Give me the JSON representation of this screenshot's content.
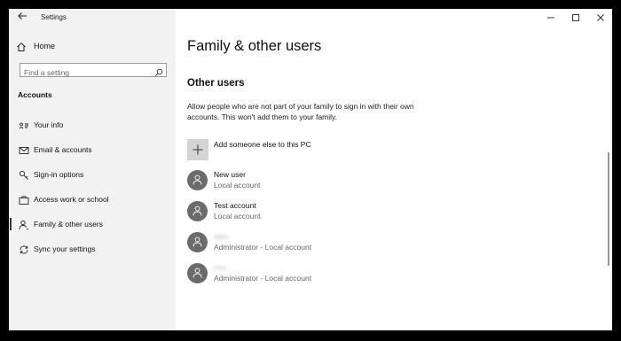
{
  "window": {
    "title": "Settings"
  },
  "sidebar": {
    "home_label": "Home",
    "search_placeholder": "Find a setting",
    "section_title": "Accounts",
    "items": [
      {
        "label": "Your info",
        "icon": "id-card-icon"
      },
      {
        "label": "Email & accounts",
        "icon": "email-icon"
      },
      {
        "label": "Sign-in options",
        "icon": "key-icon"
      },
      {
        "label": "Access work or school",
        "icon": "briefcase-icon"
      },
      {
        "label": "Family & other users",
        "icon": "people-icon",
        "active": true
      },
      {
        "label": "Sync your settings",
        "icon": "sync-icon"
      }
    ]
  },
  "main": {
    "page_title": "Family & other users",
    "section_title": "Other users",
    "description": "Allow people who are not part of your family to sign in with their own accounts. This won't add them to your family.",
    "add_label": "Add someone else to this PC",
    "users": [
      {
        "name": "New user",
        "role": "Local account",
        "blurred": false
      },
      {
        "name": "Test account",
        "role": "Local account",
        "blurred": false
      },
      {
        "name": "ddm",
        "role": "Administrator - Local account",
        "blurred": true
      },
      {
        "name": "cho",
        "role": "Administrator - Local account",
        "blurred": true
      }
    ]
  },
  "colors": {
    "sidebar_bg": "#f2f2f2",
    "avatar_bg": "#6b6b6b",
    "add_tile_bg": "#d4d4d4"
  }
}
